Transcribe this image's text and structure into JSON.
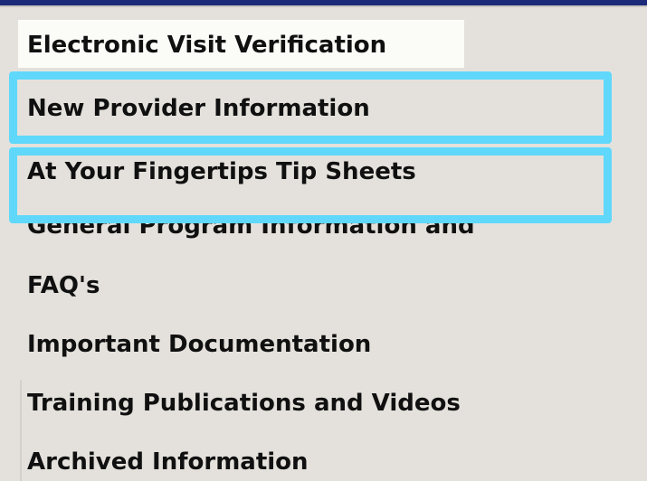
{
  "nav": {
    "header_label": "Electronic Visit Verification",
    "items": [
      {
        "label": "New Provider Information",
        "highlighted": true
      },
      {
        "label": "At Your Fingertips Tip Sheets",
        "highlighted": true
      },
      {
        "label": "General Program Information and",
        "highlighted": false
      },
      {
        "label": "FAQ's",
        "highlighted": false
      },
      {
        "label": "Important Documentation",
        "highlighted": false
      },
      {
        "label": "Training Publications and Videos",
        "highlighted": false
      },
      {
        "label": "Archived Information",
        "highlighted": false
      }
    ]
  },
  "colors": {
    "top_bar": "#1c2a7a",
    "background": "#e4e1dc",
    "header_background": "#fbfbf8",
    "highlight": "#5fd8fb",
    "text": "#101010"
  }
}
